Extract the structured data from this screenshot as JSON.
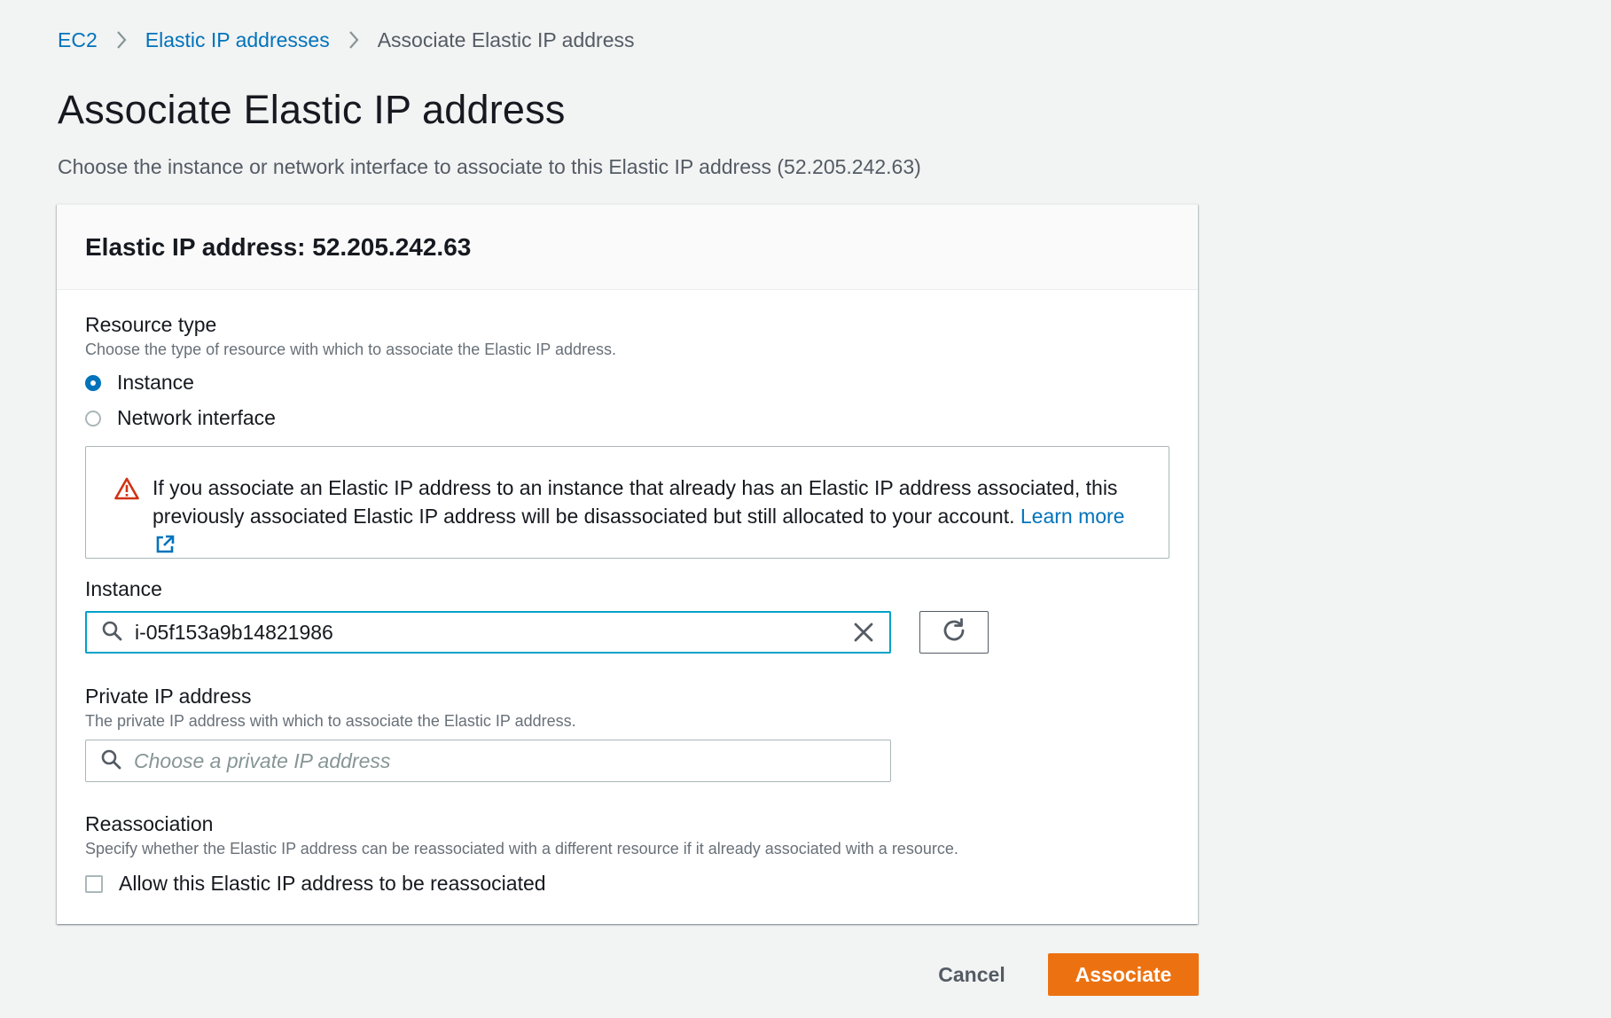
{
  "breadcrumb": {
    "items": [
      {
        "label": "EC2"
      },
      {
        "label": "Elastic IP addresses"
      },
      {
        "label": "Associate Elastic IP address"
      }
    ]
  },
  "page": {
    "title": "Associate Elastic IP address",
    "description": "Choose the instance or network interface to associate to this Elastic IP address (52.205.242.63)"
  },
  "panel": {
    "title": "Elastic IP address: 52.205.242.63"
  },
  "resource_type": {
    "label": "Resource type",
    "description": "Choose the type of resource with which to associate the Elastic IP address.",
    "options": [
      {
        "label": "Instance",
        "selected": true
      },
      {
        "label": "Network interface",
        "selected": false
      }
    ]
  },
  "alert": {
    "icon": "warning-triangle-icon",
    "color": "#d13212",
    "text": "If you associate an Elastic IP address to an instance that already has an Elastic IP address associated, this previously associated Elastic IP address will be disassociated but still allocated to your account. ",
    "link_label": "Learn more"
  },
  "instance": {
    "label": "Instance",
    "value": "i-05f153a9b14821986"
  },
  "private_ip": {
    "label": "Private IP address",
    "description": "The private IP address with which to associate the Elastic IP address.",
    "placeholder": "Choose a private IP address"
  },
  "reassociation": {
    "label": "Reassociation",
    "description": "Specify whether the Elastic IP address can be reassociated with a different resource if it already associated with a resource.",
    "checkbox_label": "Allow this Elastic IP address to be reassociated",
    "checked": false
  },
  "actions": {
    "cancel_label": "Cancel",
    "submit_label": "Associate"
  },
  "colors": {
    "link": "#0073bb",
    "primary_button": "#ec7211",
    "focus_border": "#00a1c9",
    "warning": "#d13212",
    "background": "#f2f3f3"
  }
}
